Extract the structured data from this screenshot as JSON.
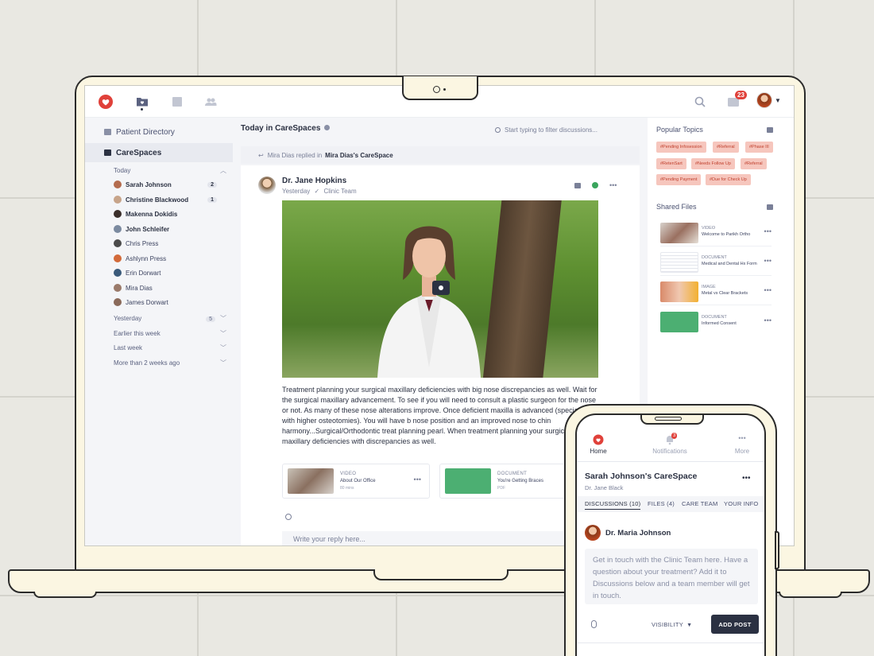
{
  "app": {
    "notifications_badge": "23",
    "colors": {
      "brand": "#e0413a",
      "accent": "#2b3142",
      "tag_bg": "#f6c6bd",
      "tag_text": "#c0402e"
    }
  },
  "sidebar": {
    "links": [
      {
        "label": "Patient Directory",
        "icon": "directory-icon"
      },
      {
        "label": "CareSpaces",
        "icon": "carespaces-icon",
        "active": true
      }
    ],
    "today_label": "Today",
    "people": [
      {
        "name": "Sarah Johnson",
        "count": "2",
        "unread": true
      },
      {
        "name": "Christine Blackwood",
        "count": "1",
        "unread": true
      },
      {
        "name": "Makenna Dokidis",
        "count": "",
        "unread": true
      },
      {
        "name": "John Schleifer",
        "count": "",
        "unread": true
      },
      {
        "name": "Chris Press",
        "count": "",
        "unread": false
      },
      {
        "name": "Ashlynn Press",
        "count": "",
        "unread": false
      },
      {
        "name": "Erin Dorwart",
        "count": "",
        "unread": false
      },
      {
        "name": "Mira Dias",
        "count": "",
        "unread": false
      },
      {
        "name": "James Dorwart",
        "count": "",
        "unread": false
      }
    ],
    "groups": [
      {
        "label": "Yesterday",
        "count": "5"
      },
      {
        "label": "Earlier this week",
        "count": ""
      },
      {
        "label": "Last week",
        "count": ""
      },
      {
        "label": "More than 2 weeks ago",
        "count": ""
      }
    ]
  },
  "feed": {
    "title": "Today in CareSpaces",
    "filter_placeholder": "Start typing to filter discussions...",
    "reply_note_prefix": "Mira Dias replied in",
    "reply_note_target": "Mira Dias's CareSpace",
    "post": {
      "author": "Dr. Jane Hopkins",
      "time": "Yesterday",
      "team": "Clinic Team",
      "body": "Treatment planning your surgical maxillary deficiencies with big nose discrepancies as well. Wait for the surgical maxillary advancement. To see if you will need to consult a plastic surgeon for the nose or not. As many of these nose alterations improve. Once deficient maxilla is advanced (specially it with higher osteotomies). You will have b nose position and an improved nose to chin harmony...Surgical/Orthodontic treat planning pearl. When treatment planning your surgical maxillary deficiencies with discrepancies as well.",
      "attachments": [
        {
          "kind": "VIDEO",
          "title": "About Our Office",
          "sub": "80 mins"
        },
        {
          "kind": "DOCUMENT",
          "title": "You're Getting Braces",
          "sub": "PDF"
        }
      ],
      "reply_placeholder": "Write your reply here..."
    }
  },
  "right": {
    "popular_title": "Popular Topics",
    "tags": [
      "#Pending Infosession",
      "#Referral",
      "#Phase III",
      "#RetenSart",
      "#Needs Follow Up",
      "#Referral",
      "#Pending Payment",
      "#Due for Check Up"
    ],
    "files_title": "Shared Files",
    "files": [
      {
        "kind": "VIDEO",
        "title": "Welcome to Parikh Ortho"
      },
      {
        "kind": "DOCUMENT",
        "title": "Medical and Dental Hx Form"
      },
      {
        "kind": "IMAGE",
        "title": "Metal vs Clear Brackets"
      },
      {
        "kind": "DOCUMENT",
        "title": "Informed Consent"
      }
    ]
  },
  "phone": {
    "tabs": [
      {
        "label": "Home",
        "icon": "home-heart-icon"
      },
      {
        "label": "Notifications",
        "icon": "bell-icon",
        "badge": "3"
      },
      {
        "label": "More",
        "icon": "more-icon"
      }
    ],
    "space_title": "Sarah Johnson's CareSpace",
    "space_sub": "Dr. Jane Black",
    "section_tabs": [
      "DISCUSSIONS (10)",
      "FILES (4)",
      "CARE TEAM",
      "YOUR INFO"
    ],
    "author": "Dr. Maria Johnson",
    "compose_placeholder": "Get in touch with the Clinic Team here. Have a question about your treatment? Add it to Discussions below and a team member will get in touch.",
    "visibility_label": "VISIBILITY",
    "add_post_label": "ADD POST"
  }
}
